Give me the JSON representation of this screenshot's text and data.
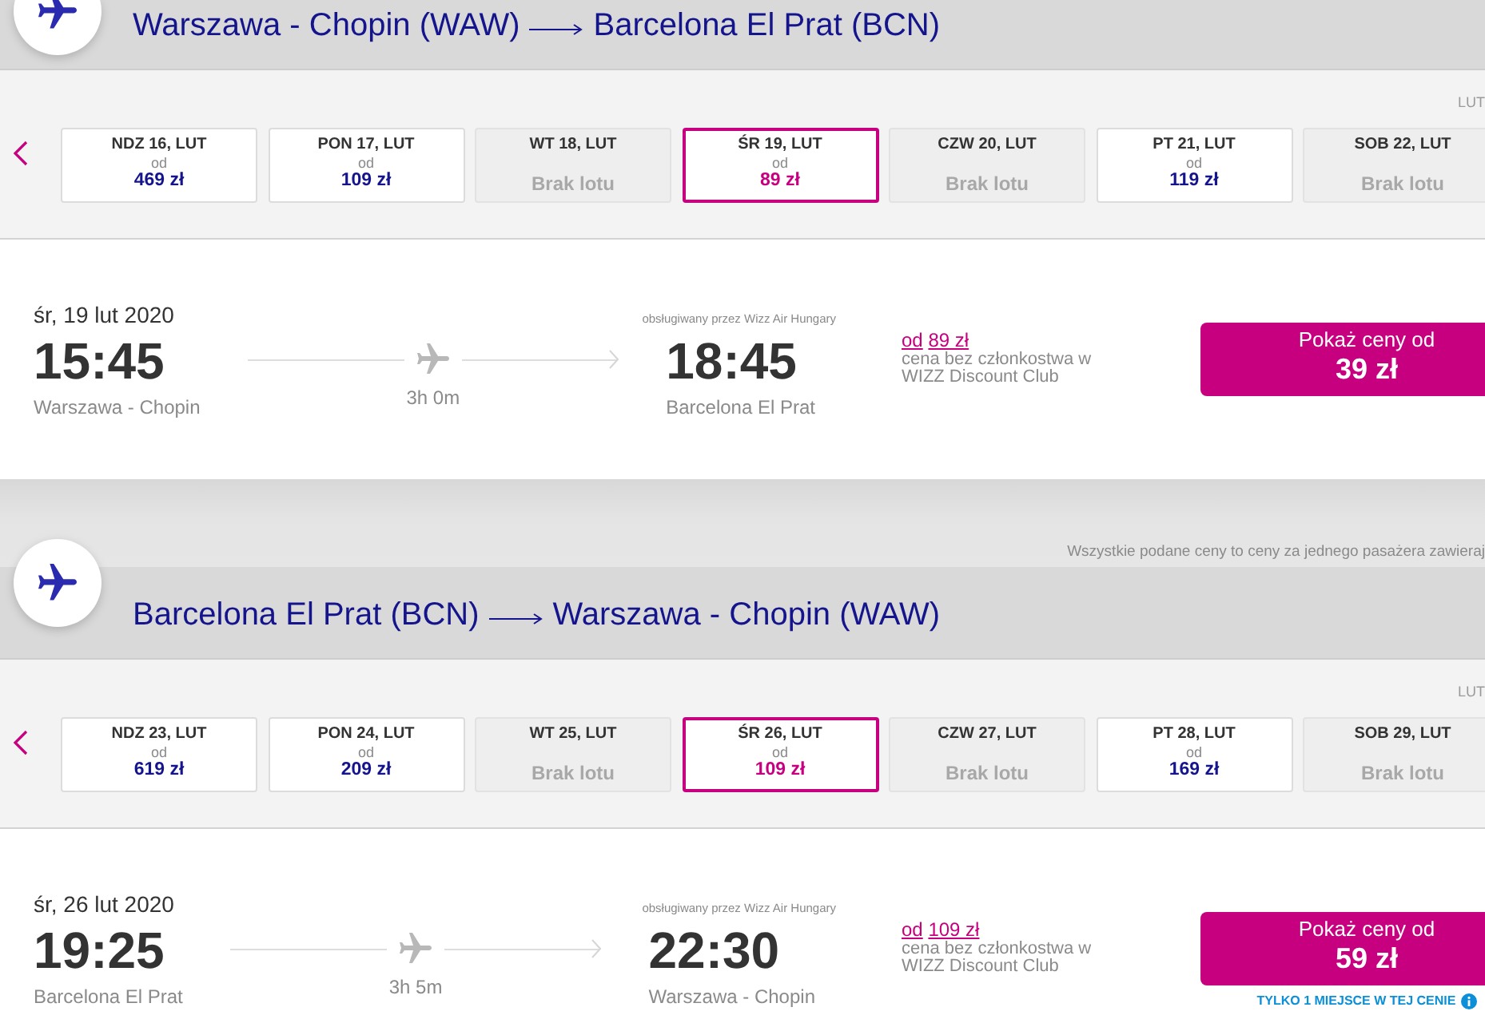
{
  "outbound": {
    "route": {
      "origin": "Warszawa - Chopin (WAW)",
      "destination": "Barcelona El Prat (BCN)"
    },
    "month_label": "LUT",
    "dates": [
      {
        "day": "NDZ 16, LUT",
        "from": "od",
        "price": "469 zł",
        "available": true,
        "selected": false
      },
      {
        "day": "PON 17, LUT",
        "from": "od",
        "price": "109 zł",
        "available": true,
        "selected": false
      },
      {
        "day": "WT 18, LUT",
        "no_flight": "Brak lotu",
        "available": false,
        "selected": false
      },
      {
        "day": "ŚR 19, LUT",
        "from": "od",
        "price": "89 zł",
        "available": true,
        "selected": true
      },
      {
        "day": "CZW 20, LUT",
        "no_flight": "Brak lotu",
        "available": false,
        "selected": false
      },
      {
        "day": "PT 21, LUT",
        "from": "od",
        "price": "119 zł",
        "available": true,
        "selected": false
      },
      {
        "day": "SOB 22, LUT",
        "no_flight": "Brak lotu",
        "available": false,
        "selected": false
      }
    ],
    "flight": {
      "date": "śr, 19 lut 2020",
      "operator": "obsługiwany przez Wizz Air Hungary",
      "departure_time": "15:45",
      "departure_airport": "Warszawa - Chopin",
      "duration": "3h 0m",
      "arrival_time": "18:45",
      "arrival_airport": "Barcelona El Prat",
      "regular_from": "od",
      "regular_price": "89 zł",
      "regular_note": "cena bez członkostwa w WIZZ Discount Club",
      "button_label": "Pokaż ceny od",
      "button_price": "39 zł"
    }
  },
  "price_notice": "Wszystkie podane ceny to ceny za jednego pasażera zawieraj",
  "return": {
    "route": {
      "origin": "Barcelona El Prat (BCN)",
      "destination": "Warszawa - Chopin (WAW)"
    },
    "month_label": "LUT",
    "dates": [
      {
        "day": "NDZ 23, LUT",
        "from": "od",
        "price": "619 zł",
        "available": true,
        "selected": false
      },
      {
        "day": "PON 24, LUT",
        "from": "od",
        "price": "209 zł",
        "available": true,
        "selected": false
      },
      {
        "day": "WT 25, LUT",
        "no_flight": "Brak lotu",
        "available": false,
        "selected": false
      },
      {
        "day": "ŚR 26, LUT",
        "from": "od",
        "price": "109 zł",
        "available": true,
        "selected": true
      },
      {
        "day": "CZW 27, LUT",
        "no_flight": "Brak lotu",
        "available": false,
        "selected": false
      },
      {
        "day": "PT 28, LUT",
        "from": "od",
        "price": "169 zł",
        "available": true,
        "selected": false
      },
      {
        "day": "SOB 29, LUT",
        "no_flight": "Brak lotu",
        "available": false,
        "selected": false
      }
    ],
    "flight": {
      "date": "śr, 26 lut 2020",
      "operator": "obsługiwany przez Wizz Air Hungary",
      "departure_time": "19:25",
      "departure_airport": "Barcelona El Prat",
      "duration": "3h 5m",
      "arrival_time": "22:30",
      "arrival_airport": "Warszawa - Chopin",
      "regular_from": "od",
      "regular_price": "109 zł",
      "regular_note": "cena bez członkostwa w WIZZ Discount Club",
      "button_label": "Pokaż ceny od",
      "button_price": "59 zł",
      "seats_note": "TYLKO 1 MIEJSCE W TEJ CENIE"
    }
  }
}
